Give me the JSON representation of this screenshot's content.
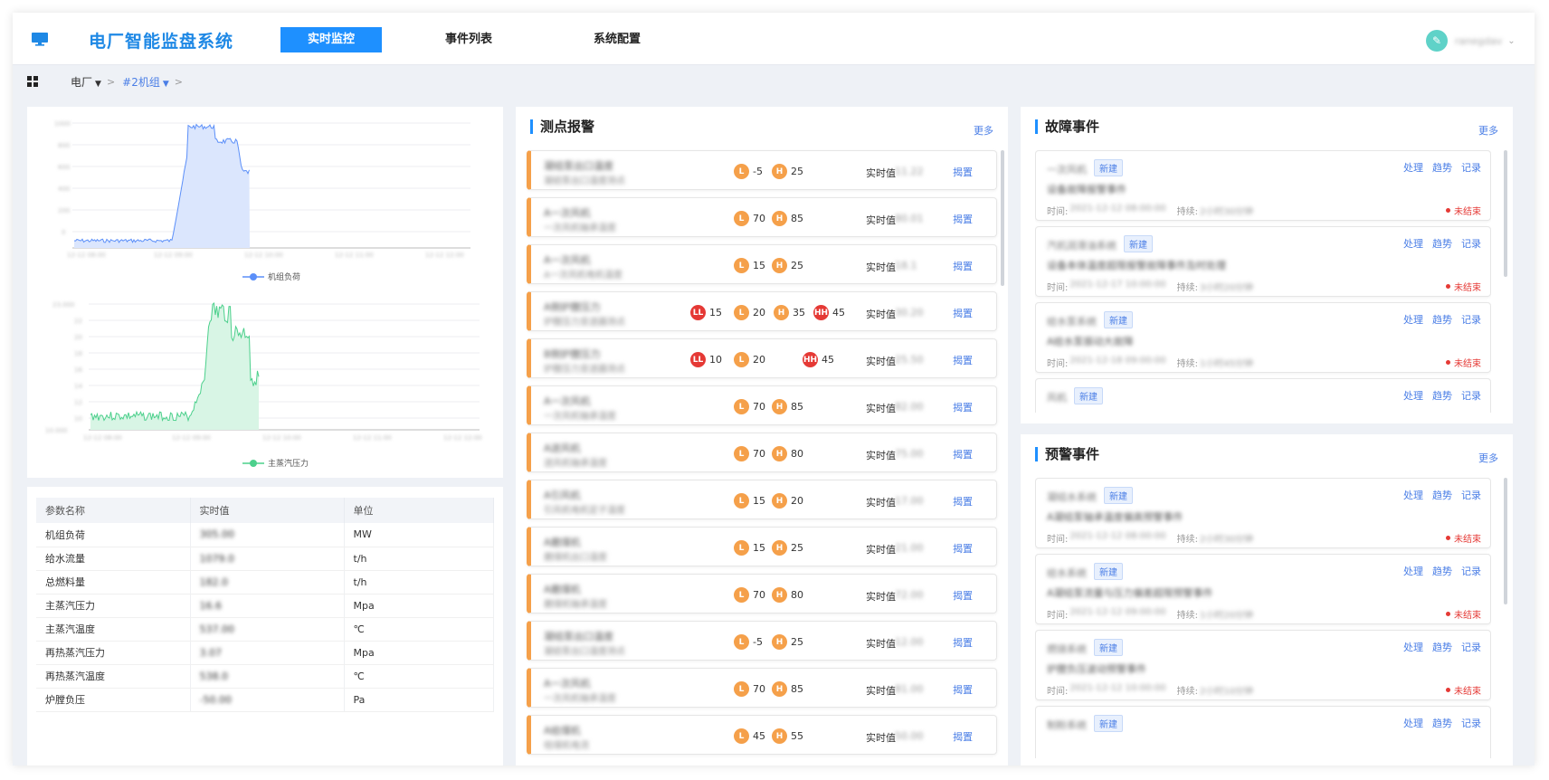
{
  "header": {
    "title": "电厂智能监盘系统",
    "nav": [
      "实时监控",
      "事件列表",
      "系统配置"
    ],
    "active_nav": 0,
    "user_name": "ranegdav"
  },
  "breadcrumb": {
    "plant": "电厂",
    "unit": "#2机组"
  },
  "charts": {
    "top": {
      "legend": "机组负荷",
      "color": "#5b8ff9"
    },
    "bottom": {
      "legend": "主蒸汽压力",
      "color": "#4cd08c"
    }
  },
  "params_table": {
    "headers": [
      "参数名称",
      "实时值",
      "单位"
    ],
    "rows": [
      {
        "name": "机组负荷",
        "value": "305.00",
        "unit": "MW"
      },
      {
        "name": "给水流量",
        "value": "1079.0",
        "unit": "t/h"
      },
      {
        "name": "总燃料量",
        "value": "182.0",
        "unit": "t/h"
      },
      {
        "name": "主蒸汽压力",
        "value": "16.6",
        "unit": "Mpa"
      },
      {
        "name": "主蒸汽温度",
        "value": "537.00",
        "unit": "℃"
      },
      {
        "name": "再热蒸汽压力",
        "value": "3.07",
        "unit": "Mpa"
      },
      {
        "name": "再热蒸汽温度",
        "value": "538.0",
        "unit": "℃"
      },
      {
        "name": "炉膛负压",
        "value": "-50.00",
        "unit": "Pa"
      }
    ]
  },
  "alarm_panel": {
    "title": "测点报警",
    "more": "更多",
    "rt_label": "实时值",
    "ack_label": "揭置",
    "items": [
      {
        "name": "凝结泵出口温度",
        "desc": "凝结泵出口温度测点",
        "L": "-5",
        "H": "25",
        "value": "11.22"
      },
      {
        "name": "A一次风机",
        "desc": "一次风机轴承温度",
        "L": "70",
        "H": "85",
        "value": "80.01"
      },
      {
        "name": "A一次风机",
        "desc": "A一次风机电机温度",
        "L": "15",
        "H": "25",
        "value": "18.1"
      },
      {
        "name": "A侧炉膛压力",
        "desc": "炉膛压力变送器测点",
        "LL": "15",
        "L": "20",
        "H": "35",
        "HH": "45",
        "value": "30.20"
      },
      {
        "name": "B侧炉膛压力",
        "desc": "炉膛压力变送器测点",
        "LL": "10",
        "L": "20",
        "HH": "45",
        "value": "25.50"
      },
      {
        "name": "A一次风机",
        "desc": "一次风机轴承温度",
        "L": "70",
        "H": "85",
        "value": "82.00"
      },
      {
        "name": "A送风机",
        "desc": "送风机轴承温度",
        "L": "70",
        "H": "80",
        "value": "75.00"
      },
      {
        "name": "A引风机",
        "desc": "引风机电机定子温度",
        "L": "15",
        "H": "20",
        "value": "17.00"
      },
      {
        "name": "A磨煤机",
        "desc": "磨煤机出口温度",
        "L": "15",
        "H": "25",
        "value": "21.00"
      },
      {
        "name": "A磨煤机",
        "desc": "磨煤机轴承温度",
        "L": "70",
        "H": "80",
        "value": "72.00"
      },
      {
        "name": "凝结泵出口温度",
        "desc": "凝结泵出口温度测点",
        "L": "-5",
        "H": "25",
        "value": "12.00"
      },
      {
        "name": "A一次风机",
        "desc": "一次风机轴承温度",
        "L": "70",
        "H": "85",
        "value": "81.00"
      },
      {
        "name": "A给煤机",
        "desc": "给煤机电流",
        "L": "45",
        "H": "55",
        "value": "50.00"
      }
    ]
  },
  "fault_panel": {
    "title": "故障事件",
    "more": "更多",
    "actions": [
      "处理",
      "趋势",
      "记录"
    ],
    "badge": "新建",
    "time_label": "时间:",
    "dur_label": "持续:",
    "status": "未结束",
    "items": [
      {
        "name": "一次风机",
        "desc": "设备故障报警事件",
        "time": "2021-12-12 08:00:00",
        "dur": "2小时30分钟"
      },
      {
        "name": "汽机润滑油系统",
        "desc": "设备本体温度超限报警故障事件及时处理",
        "time": "2021-12-17 10:00:00",
        "dur": "3小时20分钟"
      },
      {
        "name": "给水泵系统",
        "desc": "A给水泵振动大故障",
        "time": "2021-12-18 09:00:00",
        "dur": "1小时45分钟"
      },
      {
        "name": "风机",
        "desc": "",
        "time": "",
        "dur": ""
      }
    ]
  },
  "warn_panel": {
    "title": "预警事件",
    "more": "更多",
    "actions": [
      "处理",
      "趋势",
      "记录"
    ],
    "badge": "新建",
    "time_label": "时间:",
    "dur_label": "持续:",
    "status": "未结束",
    "items": [
      {
        "name": "凝结水系统",
        "desc": "A凝结泵轴承温度偏高预警事件",
        "time": "2021-12-12 08:00:00",
        "dur": "2小时30分钟"
      },
      {
        "name": "给水系统",
        "desc": "A凝结泵流量与压力偏差超限预警事件",
        "time": "2021-12-12 09:00:00",
        "dur": "1小时20分钟"
      },
      {
        "name": "燃烧系统",
        "desc": "炉膛负压波动预警事件",
        "time": "2021-12-12 10:00:00",
        "dur": "2小时10分钟"
      },
      {
        "name": "制粉系统",
        "desc": "",
        "time": "",
        "dur": ""
      }
    ]
  }
}
